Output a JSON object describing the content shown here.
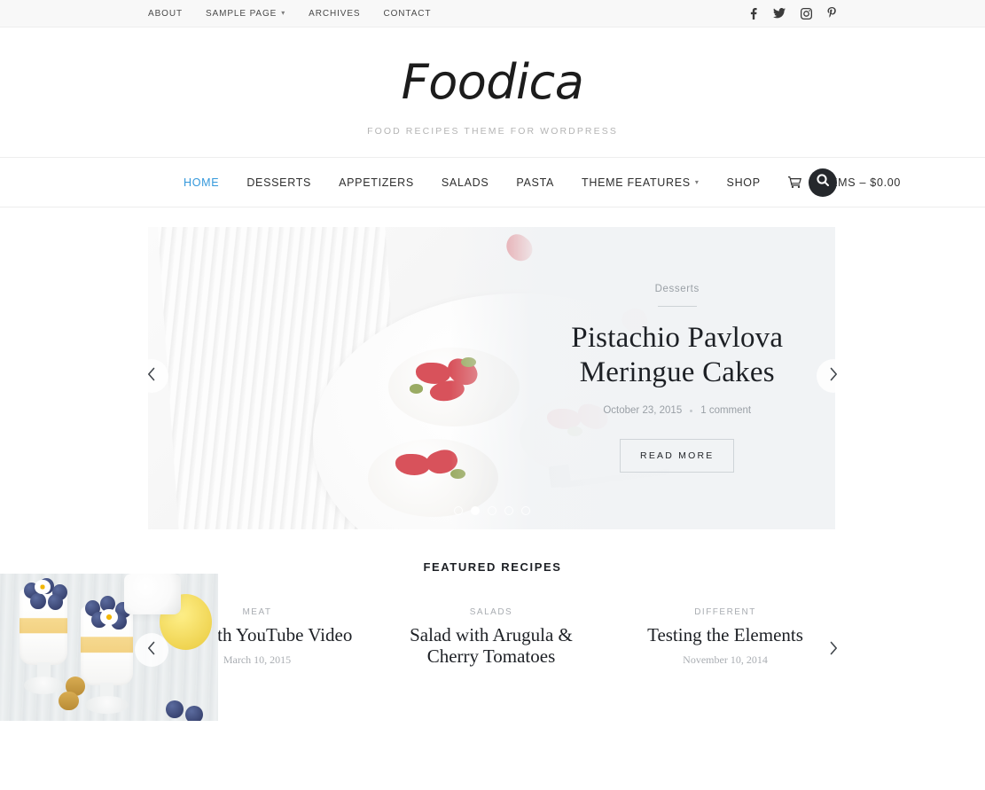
{
  "topbar": {
    "nav": [
      {
        "label": "ABOUT",
        "has_caret": false
      },
      {
        "label": "SAMPLE PAGE",
        "has_caret": true
      },
      {
        "label": "ARCHIVES",
        "has_caret": false
      },
      {
        "label": "CONTACT",
        "has_caret": false
      }
    ],
    "social": [
      "facebook-icon",
      "twitter-icon",
      "instagram-icon",
      "pinterest-icon"
    ]
  },
  "branding": {
    "logo": "Foodica",
    "tagline": "FOOD RECIPES THEME FOR WORDPRESS"
  },
  "mainnav": {
    "items": [
      {
        "label": "HOME",
        "active": true,
        "has_caret": false
      },
      {
        "label": "DESSERTS",
        "active": false,
        "has_caret": false
      },
      {
        "label": "APPETIZERS",
        "active": false,
        "has_caret": false
      },
      {
        "label": "SALADS",
        "active": false,
        "has_caret": false
      },
      {
        "label": "PASTA",
        "active": false,
        "has_caret": false
      },
      {
        "label": "THEME FEATURES",
        "active": false,
        "has_caret": true
      },
      {
        "label": "SHOP",
        "active": false,
        "has_caret": false
      }
    ],
    "cart_label": "0 ITEMS – $0.00",
    "active_color": "#3498db",
    "search_button_color": "#25282c"
  },
  "hero": {
    "category": "Desserts",
    "title": "Pistachio Pavlova Meringue Cakes",
    "date": "October 23, 2015",
    "comments": "1 comment",
    "read_more": "READ MORE",
    "slide_count": 5,
    "active_slide": 2,
    "prev_label": "‹",
    "next_label": "›"
  },
  "featured": {
    "heading": "FEATURED RECIPES",
    "prev_label": "‹",
    "next_label": "›",
    "cards": [
      {
        "category": "MEAT",
        "title": "Post with YouTube Video",
        "date": "March 10, 2015"
      },
      {
        "category": "SALADS",
        "title": "Salad with Arugula & Cherry Tomatoes",
        "date": ""
      },
      {
        "category": "DIFFERENT",
        "title": "Testing the Elements",
        "date": "November 10, 2014"
      }
    ]
  }
}
